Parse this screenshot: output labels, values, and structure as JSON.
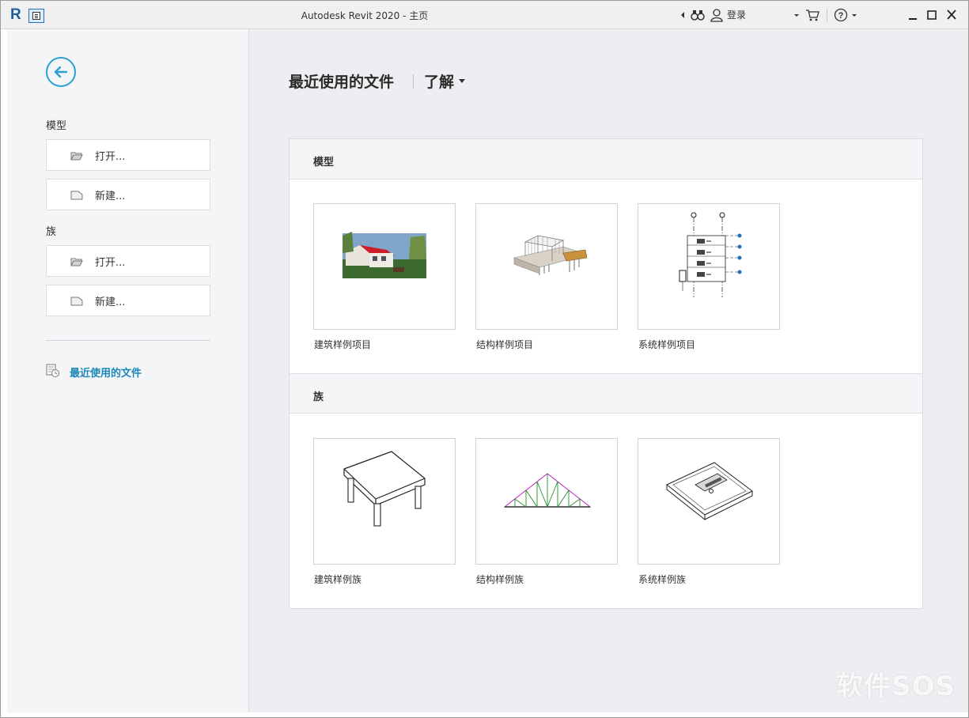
{
  "titlebar": {
    "title": "Autodesk Revit 2020 - 主页",
    "login_label": "登录"
  },
  "sidebar": {
    "model_heading": "模型",
    "model_open": "打开...",
    "model_new": "新建...",
    "family_heading": "族",
    "family_open": "打开...",
    "family_new": "新建...",
    "recent_link": "最近使用的文件"
  },
  "main": {
    "tabs": [
      "最近使用的文件",
      "了解"
    ],
    "sections": [
      {
        "title": "模型",
        "items": [
          "建筑样例项目",
          "结构样例项目",
          "系统样例项目"
        ]
      },
      {
        "title": "族",
        "items": [
          "建筑样例族",
          "结构样例族",
          "系统样例族"
        ]
      }
    ]
  },
  "watermark": "软件SOS",
  "colors": {
    "accent": "#2ba0d2",
    "link": "#1b87b8",
    "sidebar_bg": "#f4f5f7",
    "main_bg": "#eceef1"
  },
  "icons": [
    "revit-logo-icon",
    "quick-access-icon",
    "binoculars-icon",
    "user-icon",
    "cart-icon",
    "help-icon",
    "minimize-icon",
    "maximize-icon",
    "close-icon",
    "back-arrow-icon",
    "folder-open-icon",
    "new-file-icon",
    "recent-files-icon"
  ]
}
